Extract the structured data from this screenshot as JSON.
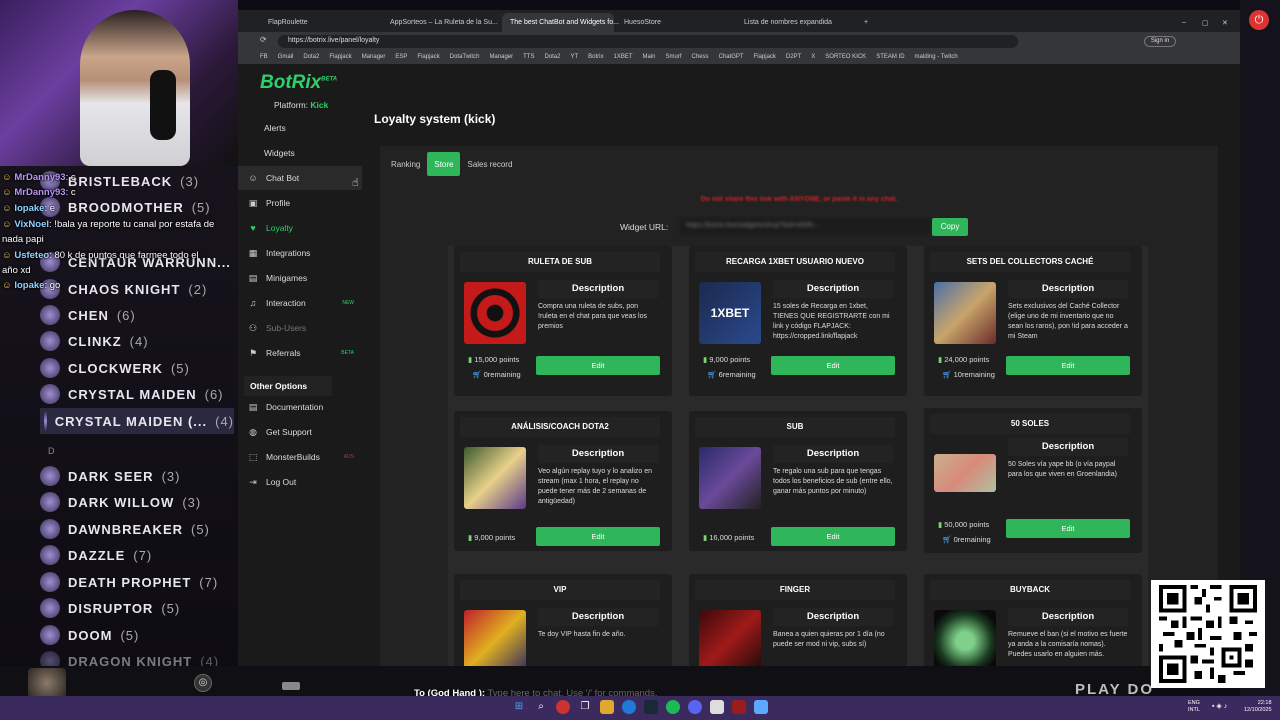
{
  "chat": [
    {
      "user": "MrDanny93",
      "msg": ": c"
    },
    {
      "user": "MrDanny93",
      "msg": ": c"
    },
    {
      "user": "lopake",
      "msg": ": e"
    },
    {
      "user": "VixNoel",
      "msg": ": !bala ya reporte tu canal por estafa de"
    },
    {
      "user": "",
      "msg": "nada papi"
    },
    {
      "user": "Usfeteo",
      "msg": ": 80 k de puntos que farmee todo el"
    },
    {
      "user": "",
      "msg": "año xd"
    },
    {
      "user": "lopake",
      "msg": ": go"
    }
  ],
  "heroes": [
    {
      "name": "BRISTLEBACK",
      "count": "(3)"
    },
    {
      "name": "BROODMOTHER",
      "count": "(5)"
    },
    {
      "name": "CENTAUR WARRUNN...",
      "count": "(4)"
    },
    {
      "name": "CHAOS KNIGHT",
      "count": "(2)"
    },
    {
      "name": "CHEN",
      "count": "(6)"
    },
    {
      "name": "CLINKZ",
      "count": "(4)"
    },
    {
      "name": "CLOCKWERK",
      "count": "(5)"
    },
    {
      "name": "CRYSTAL MAIDEN",
      "count": "(6)"
    },
    {
      "name": "CRYSTAL MAIDEN (...",
      "count": "(4)"
    },
    {
      "name": "DARK SEER",
      "count": "(3)"
    },
    {
      "name": "DARK WILLOW",
      "count": "(3)"
    },
    {
      "name": "DAWNBREAKER",
      "count": "(5)"
    },
    {
      "name": "DAZZLE",
      "count": "(7)"
    },
    {
      "name": "DEATH PROPHET",
      "count": "(7)"
    },
    {
      "name": "DISRUPTOR",
      "count": "(5)"
    },
    {
      "name": "DOOM",
      "count": "(5)"
    },
    {
      "name": "DRAGON KNIGHT",
      "count": "(4)"
    }
  ],
  "hero_letter": "D",
  "browser": {
    "tabs": [
      "FlapRoulette",
      "AppSorteos – La Ruleta de la Su...",
      "The best ChatBot and Widgets fo...",
      "HuesoStore",
      "Lista de nombres expandida"
    ],
    "url": "https://botrix.live/panel/loyalty",
    "sign_in": "Sign in",
    "bookmarks": [
      "FB",
      "Gmail",
      "Dota2",
      "Flapjack",
      "Manager",
      "ESP",
      "Flapjack",
      "DotaTwitch",
      "Manager",
      "TTS",
      "Dota2",
      "YT",
      "Botrix",
      "1XBET",
      "Main",
      "Smurf",
      "Chess",
      "ChatGPT",
      "Flapjack",
      "D2PT",
      "X",
      "SORTEO KICK",
      "STEAM ID",
      "malding - Twitch"
    ]
  },
  "sidebar": {
    "logo": "BotRix",
    "logo_beta": "BETA",
    "platform_label": "Platform:",
    "platform_value": "Kick",
    "items": [
      {
        "label": "Alerts"
      },
      {
        "label": "Widgets"
      },
      {
        "label": "Chat Bot"
      },
      {
        "label": "Profile"
      },
      {
        "label": "Loyalty"
      },
      {
        "label": "Integrations"
      },
      {
        "label": "Minigames"
      },
      {
        "label": "Interaction",
        "badge": "NEW"
      },
      {
        "label": "Sub-Users"
      },
      {
        "label": "Referrals",
        "badge": "BETA"
      }
    ],
    "other_title": "Other Options",
    "other_items": [
      {
        "label": "Documentation"
      },
      {
        "label": "Get Support"
      },
      {
        "label": "MonsterBuilds",
        "badge": "ADS"
      },
      {
        "label": "Log Out"
      }
    ]
  },
  "content": {
    "title": "Loyalty system (kick)",
    "tabs": [
      "Ranking",
      "Store",
      "Sales record"
    ],
    "warning": "Do not share this link with ANYONE, or paste it in any chat.",
    "widget_label": "Widget URL:",
    "widget_url": "https://botrix.live/widgets/shop?bid=e60fc...",
    "copy": "Copy",
    "description_label": "Description",
    "edit_label": "Edit",
    "cards": [
      {
        "title": "RULETA DE SUB",
        "desc": "Compra una ruleta de subs, pon !ruleta en el chat para que veas los premios",
        "points": "15,000 points",
        "remaining": "0remaining"
      },
      {
        "title": "RECARGA 1XBET USUARIO NUEVO",
        "desc": "15 soles de Recarga en 1xbet, TIENES QUE REGISTRARTE con mi link y código FLAPJACK: https://cropped.link/flapjack",
        "points": "9,000 points",
        "remaining": "6remaining"
      },
      {
        "title": "SETS DEL COLLECTORS CACHÉ",
        "desc": "Sets exclusivos del Caché Collector (elige uno de mi inventario que no sean los raros), pon !id para acceder a mi Steam",
        "points": "24,000 points",
        "remaining": "10remaining"
      },
      {
        "title": "ANÁLISIS/COACH DOTA2",
        "desc": "Veo algún replay tuyo y lo analizo en stream (max 1 hora, el replay no puede tener más de 2 semanas de antigüedad)",
        "points": "9,000 points",
        "remaining": ""
      },
      {
        "title": "SUB",
        "desc": "Te regalo una sub para que tengas todos los beneficios de sub (entre ello, ganar más puntos por minuto)",
        "points": "16,000 points",
        "remaining": ""
      },
      {
        "title": "50 SOLES",
        "desc": "50 Soles vía yape bb (o vía paypal para los que viven en Groenlandia)",
        "points": "50,000 points",
        "remaining": "0remaining"
      },
      {
        "title": "VIP",
        "desc": "Te doy VIP hasta fin de año.",
        "points": "",
        "remaining": ""
      },
      {
        "title": "FINGER",
        "desc": "Banea a quien quieras por 1 día (no puede ser mod ni vip, subs sí)",
        "points": "",
        "remaining": ""
      },
      {
        "title": "BUYBACK",
        "desc": "Remueve el ban (si el motivo es fuerte ya anda a la comisaría nomas). Puedes usarlo en alguien más.",
        "points": "",
        "remaining": ""
      }
    ]
  },
  "game": {
    "chat_prefix": "To (God Hand ):",
    "chat_placeholder": "Type here to chat. Use '/' for commands.",
    "overlay_text": "PLAY DO"
  },
  "taskbar": {
    "lang": "ENG",
    "layout": "INTL",
    "time": "22:18",
    "date": "12/10/2025"
  },
  "colors": {
    "accent": "#2fb55a",
    "brand": "#2fcf6a",
    "warning": "#cc2222",
    "taskbar": "#3b2a5e"
  }
}
